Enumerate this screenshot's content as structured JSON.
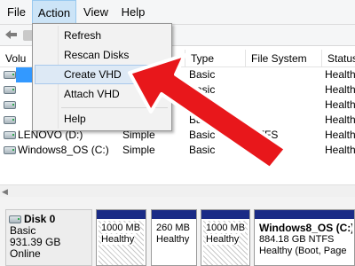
{
  "menubar": {
    "file": "File",
    "action": "Action",
    "view": "View",
    "help": "Help"
  },
  "action_menu": {
    "items": [
      "Refresh",
      "Rescan Disks",
      "Create VHD",
      "Attach VHD",
      "Help"
    ],
    "highlighted": "Create VHD"
  },
  "volume_list": {
    "headers": {
      "volume": "Volu",
      "type": "Type",
      "file_system": "File System",
      "status": "Status"
    },
    "rows": [
      {
        "volume": "",
        "layout": "",
        "type": "Basic",
        "fs": "",
        "status": "Health"
      },
      {
        "volume": "",
        "layout": "",
        "type": "Basic",
        "fs": "",
        "status": "Health"
      },
      {
        "volume": "",
        "layout": "",
        "type": "Basic",
        "fs": "",
        "status": "Health"
      },
      {
        "volume": "",
        "layout": "",
        "type": "Basic",
        "fs": "",
        "status": "Health"
      },
      {
        "volume": "LENOVO (D:)",
        "layout": "Simple",
        "type": "Basic",
        "fs": "NTFS",
        "status": "Health"
      },
      {
        "volume": "Windows8_OS (C:)",
        "layout": "Simple",
        "type": "Basic",
        "fs": "NTFS",
        "status": "Health"
      }
    ]
  },
  "disk": {
    "name": "Disk 0",
    "type": "Basic",
    "size": "931.39 GB",
    "state": "Online"
  },
  "partitions": [
    {
      "line1": "1000 MB",
      "line2": "Healthy"
    },
    {
      "line1": "260 MB",
      "line2": "Healthy"
    },
    {
      "line1": "1000 MB",
      "line2": "Healthy"
    },
    {
      "title": "Windows8_OS (C:)",
      "line1": "884.18 GB NTFS",
      "line2": "Healthy (Boot, Page"
    }
  ],
  "colors": {
    "partition_bar": "#1a2b86",
    "menu_highlight": "#dde9f5",
    "annotation_arrow": "#e8171b"
  },
  "annotation": {
    "shape": "red-arrow",
    "points_to": "Create VHD"
  }
}
